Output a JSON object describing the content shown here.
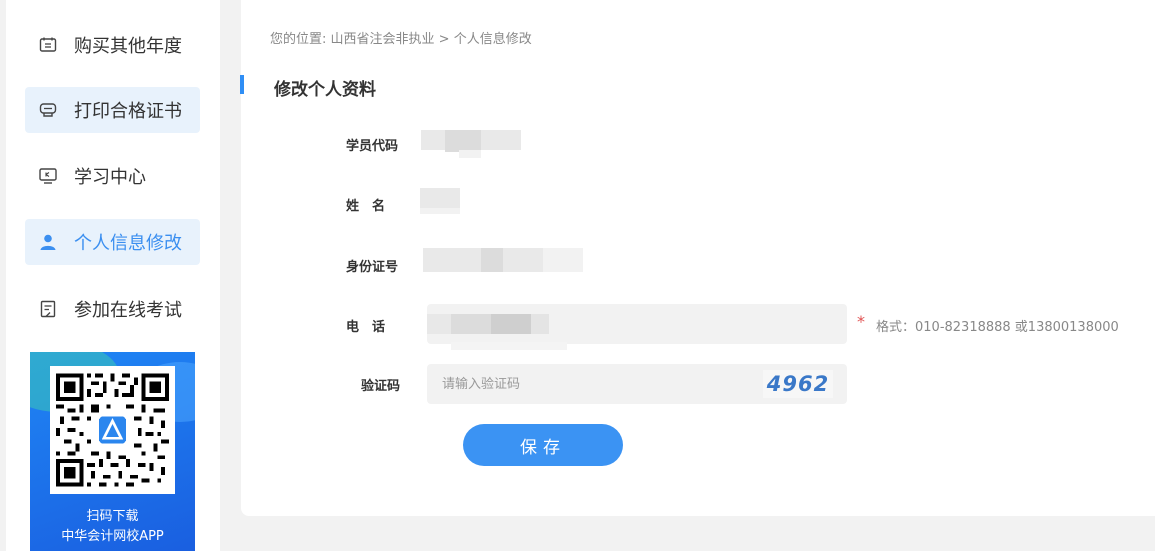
{
  "sidebar": {
    "items": [
      {
        "label": "购买其他年度",
        "icon": "calendar-icon",
        "active": false
      },
      {
        "label": "打印合格证书",
        "icon": "certificate-icon",
        "active": true
      },
      {
        "label": "学习中心",
        "icon": "monitor-icon",
        "active": false
      },
      {
        "label": "个人信息修改",
        "icon": "user-icon",
        "active": true
      },
      {
        "label": "参加在线考试",
        "icon": "exam-icon",
        "active": false
      }
    ],
    "promo": {
      "line1": "扫码下载",
      "line2": "中华会计网校APP"
    }
  },
  "breadcrumb": {
    "prefix": "您的位置:",
    "path": "山西省注会非执业 > 个人信息修改"
  },
  "form": {
    "title": "修改个人资料",
    "student_code_label": "学员代码",
    "name_label": "姓　名",
    "id_label": "身份证号",
    "phone_label": "电　话",
    "phone_required": "*",
    "phone_hint": "格式：010-82318888 或13800138000",
    "captcha_label": "验证码",
    "captcha_placeholder": "请输入验证码",
    "captcha_code": "4962",
    "save_label": "保存"
  },
  "colors": {
    "accent": "#3b93f3",
    "active_bg": "#e8f2fc",
    "required": "#e05252"
  }
}
